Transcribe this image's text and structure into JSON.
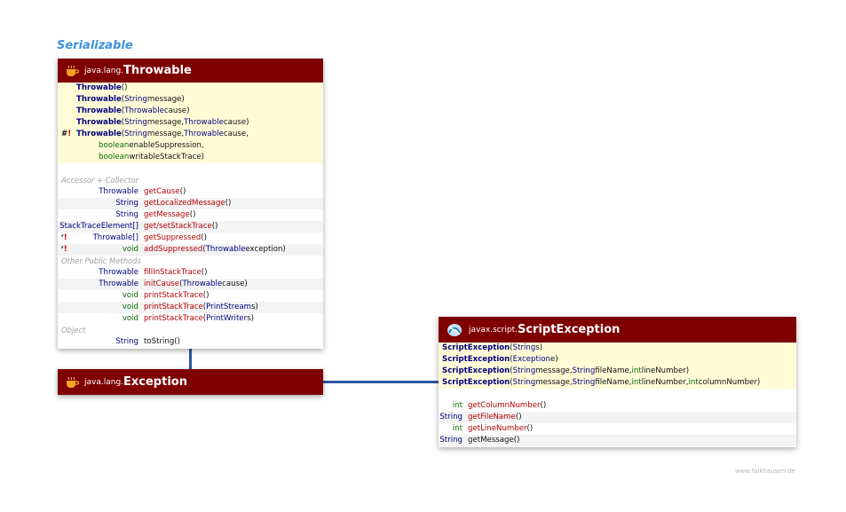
{
  "interface_label": "Serializable",
  "throwable": {
    "package": "java.lang.",
    "name": "Throwable",
    "constructors": [
      {
        "marker": "",
        "name": "Throwable",
        "args": [
          {
            "t": "plain",
            "s": " ()"
          }
        ]
      },
      {
        "marker": "",
        "name": "Throwable",
        "args": [
          {
            "t": "plain",
            "s": " ("
          },
          {
            "t": "type",
            "s": "String"
          },
          {
            "t": "plain",
            "s": " message)"
          }
        ]
      },
      {
        "marker": "",
        "name": "Throwable",
        "args": [
          {
            "t": "plain",
            "s": " ("
          },
          {
            "t": "type",
            "s": "Throwable"
          },
          {
            "t": "plain",
            "s": " cause)"
          }
        ]
      },
      {
        "marker": "",
        "name": "Throwable",
        "args": [
          {
            "t": "plain",
            "s": " ("
          },
          {
            "t": "type",
            "s": "String"
          },
          {
            "t": "plain",
            "s": " message, "
          },
          {
            "t": "type",
            "s": "Throwable"
          },
          {
            "t": "plain",
            "s": " cause)"
          }
        ]
      },
      {
        "marker": "#!",
        "name": "Throwable",
        "args": [
          {
            "t": "plain",
            "s": " ("
          },
          {
            "t": "type",
            "s": "String"
          },
          {
            "t": "plain",
            "s": " message, "
          },
          {
            "t": "type",
            "s": "Throwable"
          },
          {
            "t": "plain",
            "s": " cause,"
          }
        ]
      }
    ],
    "ctor_continuations": [
      [
        {
          "t": "prim",
          "s": "boolean"
        },
        {
          "t": "plain",
          "s": " enableSuppression,"
        }
      ],
      [
        {
          "t": "prim",
          "s": "boolean"
        },
        {
          "t": "plain",
          "s": " writableStackTrace)"
        }
      ]
    ],
    "sections": [
      {
        "title": "Accessor + Collector",
        "methods": [
          {
            "marker": "",
            "ret": "Throwable",
            "ret_kind": "type",
            "name": "getCause",
            "args": [
              {
                "t": "plain",
                "s": " ()"
              }
            ]
          },
          {
            "marker": "",
            "ret": "String",
            "ret_kind": "type",
            "name": "getLocalizedMessage",
            "args": [
              {
                "t": "plain",
                "s": " ()"
              }
            ]
          },
          {
            "marker": "",
            "ret": "String",
            "ret_kind": "type",
            "name": "getMessage",
            "args": [
              {
                "t": "plain",
                "s": " ()"
              }
            ]
          },
          {
            "marker": "",
            "ret": "StackTraceElement[]",
            "ret_kind": "type",
            "name": "get/setStackTrace",
            "args": [
              {
                "t": "plain",
                "s": " ()"
              }
            ]
          },
          {
            "marker": "f!",
            "ret": "Throwable[]",
            "ret_kind": "type",
            "name": "getSuppressed",
            "args": [
              {
                "t": "plain",
                "s": " ()"
              }
            ]
          },
          {
            "marker": "f!",
            "ret": "void",
            "ret_kind": "prim",
            "name": "addSuppressed",
            "args": [
              {
                "t": "plain",
                "s": " ("
              },
              {
                "t": "type",
                "s": "Throwable"
              },
              {
                "t": "plain",
                "s": " exception)"
              }
            ]
          }
        ]
      },
      {
        "title": "Other Public Methods",
        "methods": [
          {
            "marker": "",
            "ret": "Throwable",
            "ret_kind": "type",
            "name": "fillInStackTrace",
            "args": [
              {
                "t": "plain",
                "s": " ()"
              }
            ]
          },
          {
            "marker": "",
            "ret": "Throwable",
            "ret_kind": "type",
            "name": "initCause",
            "args": [
              {
                "t": "plain",
                "s": " ("
              },
              {
                "t": "type",
                "s": "Throwable"
              },
              {
                "t": "plain",
                "s": " cause)"
              }
            ]
          },
          {
            "marker": "",
            "ret": "void",
            "ret_kind": "prim",
            "name": "printStackTrace",
            "args": [
              {
                "t": "plain",
                "s": " ()"
              }
            ]
          },
          {
            "marker": "",
            "ret": "void",
            "ret_kind": "prim",
            "name": "printStackTrace",
            "args": [
              {
                "t": "plain",
                "s": " ("
              },
              {
                "t": "type",
                "s": "PrintStream"
              },
              {
                "t": "plain",
                "s": " s)"
              }
            ]
          },
          {
            "marker": "",
            "ret": "void",
            "ret_kind": "prim",
            "name": "printStackTrace",
            "args": [
              {
                "t": "plain",
                "s": " ("
              },
              {
                "t": "type",
                "s": "PrintWriter"
              },
              {
                "t": "plain",
                "s": " s)"
              }
            ]
          }
        ]
      },
      {
        "title": "Object",
        "methods": [
          {
            "marker": "",
            "ret": "String",
            "ret_kind": "type",
            "name": "toString",
            "name_kind": "plain",
            "args": [
              {
                "t": "plain",
                "s": " ()"
              }
            ]
          }
        ]
      }
    ]
  },
  "exception": {
    "package": "java.lang.",
    "name": "Exception"
  },
  "script_exception": {
    "package": "javax.script.",
    "name": "ScriptException",
    "constructors": [
      {
        "name": "ScriptException",
        "args": [
          {
            "t": "plain",
            "s": " ("
          },
          {
            "t": "type",
            "s": "String"
          },
          {
            "t": "plain",
            "s": " s)"
          }
        ]
      },
      {
        "name": "ScriptException",
        "args": [
          {
            "t": "plain",
            "s": " ("
          },
          {
            "t": "type",
            "s": "Exception"
          },
          {
            "t": "plain",
            "s": " e)"
          }
        ]
      },
      {
        "name": "ScriptException",
        "args": [
          {
            "t": "plain",
            "s": " ("
          },
          {
            "t": "type",
            "s": "String"
          },
          {
            "t": "plain",
            "s": " message, "
          },
          {
            "t": "type",
            "s": "String"
          },
          {
            "t": "plain",
            "s": " fileName, "
          },
          {
            "t": "prim",
            "s": "int"
          },
          {
            "t": "plain",
            "s": " lineNumber)"
          }
        ]
      },
      {
        "name": "ScriptException",
        "args": [
          {
            "t": "plain",
            "s": " ("
          },
          {
            "t": "type",
            "s": "String"
          },
          {
            "t": "plain",
            "s": " message, "
          },
          {
            "t": "type",
            "s": "String"
          },
          {
            "t": "plain",
            "s": " fileName, "
          },
          {
            "t": "prim",
            "s": "int"
          },
          {
            "t": "plain",
            "s": " lineNumber, "
          },
          {
            "t": "prim",
            "s": "int"
          },
          {
            "t": "plain",
            "s": " columnNumber)"
          }
        ]
      }
    ],
    "methods": [
      {
        "ret": "int",
        "ret_kind": "prim",
        "name": "getColumnNumber",
        "name_kind": "method",
        "args": [
          {
            "t": "plain",
            "s": " ()"
          }
        ]
      },
      {
        "ret": "String",
        "ret_kind": "type",
        "name": "getFileName",
        "name_kind": "method",
        "args": [
          {
            "t": "plain",
            "s": " ()"
          }
        ]
      },
      {
        "ret": "int",
        "ret_kind": "prim",
        "name": "getLineNumber",
        "name_kind": "method",
        "args": [
          {
            "t": "plain",
            "s": " ()"
          }
        ]
      },
      {
        "ret": "String",
        "ret_kind": "type",
        "name": "getMessage",
        "name_kind": "plain",
        "args": [
          {
            "t": "plain",
            "s": " ()"
          }
        ]
      }
    ]
  },
  "credit": "www.falkhausen.de",
  "colors": {
    "header_bg": "#7f0000",
    "ctor_bg": "#fffbd7",
    "type": "#00007f",
    "primitive": "#006f00",
    "method": "#b30000",
    "connector": "#2b57a0",
    "interface": "#3d93dd"
  }
}
